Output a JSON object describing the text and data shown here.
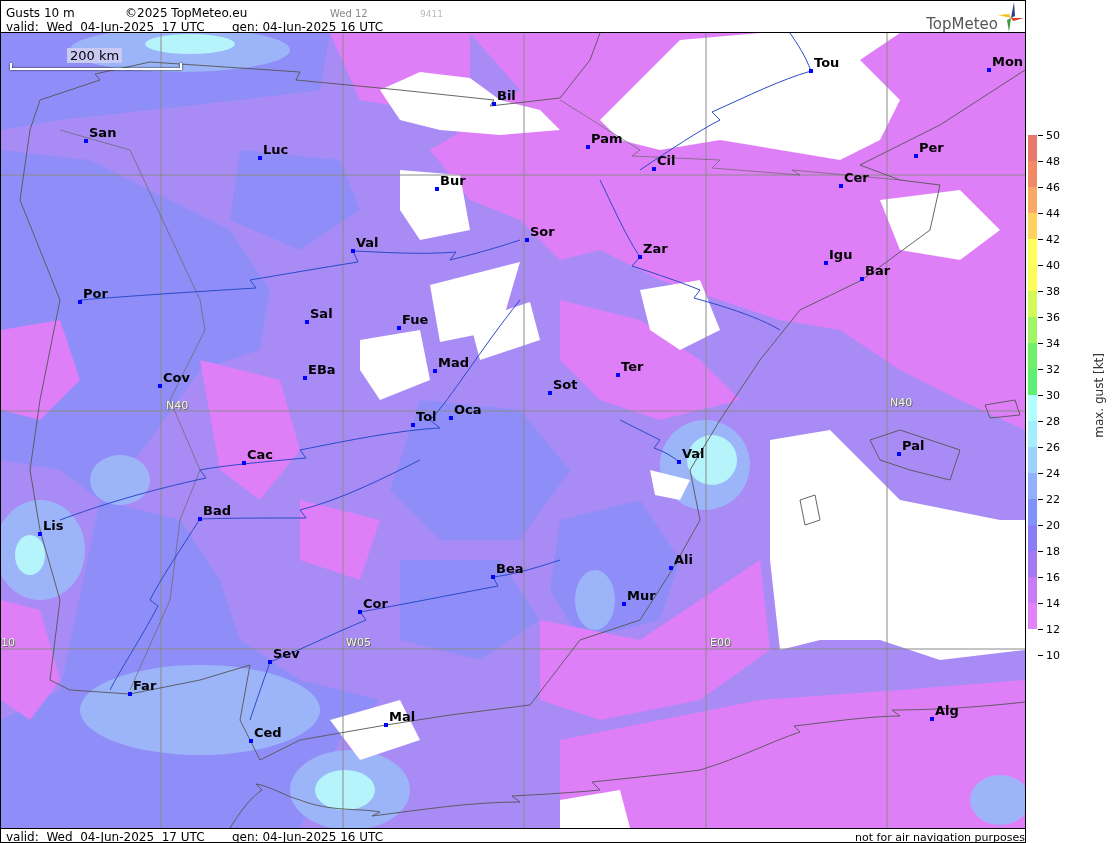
{
  "header": {
    "title": "Gusts 10 m",
    "copyright": "©2025 TopMeteo.eu",
    "day_code": "Wed 12",
    "run_code": "9411",
    "valid": "valid:  Wed  04-Jun-2025  17 UTC",
    "generated": "gen: 04-Jun-2025 16 UTC",
    "logo_text": "TopMeteo"
  },
  "map": {
    "scale_bar": "200 km",
    "grid_labels": [
      "N40",
      "N40",
      "10",
      "W05",
      "E00"
    ],
    "cities": [
      "Tou",
      "Mon",
      "Bil",
      "San",
      "Pam",
      "Per",
      "Luc",
      "Cil",
      "Cer",
      "Bur",
      "Sor",
      "Val",
      "Zar",
      "Igu",
      "Bar",
      "Por",
      "Sal",
      "Fue",
      "Mad",
      "EBa",
      "Ter",
      "Cov",
      "Sot",
      "Oca",
      "Tol",
      "Pal",
      "Val",
      "Cac",
      "Bad",
      "Lis",
      "Ali",
      "Bea",
      "Mur",
      "Cor",
      "Sev",
      "Far",
      "Alg",
      "Mal",
      "Ced"
    ]
  },
  "legend": {
    "title": "max. gust [kt]",
    "ticks": [
      "50",
      "48",
      "46",
      "44",
      "42",
      "40",
      "38",
      "36",
      "34",
      "32",
      "30",
      "28",
      "26",
      "24",
      "22",
      "20",
      "18",
      "16",
      "14",
      "12",
      "10"
    ]
  },
  "footer": {
    "valid": "valid:  Wed  04-Jun-2025  17 UTC",
    "generated": "gen: 04-Jun-2025 16 UTC",
    "disclaimer": "not for air navigation purposes"
  }
}
